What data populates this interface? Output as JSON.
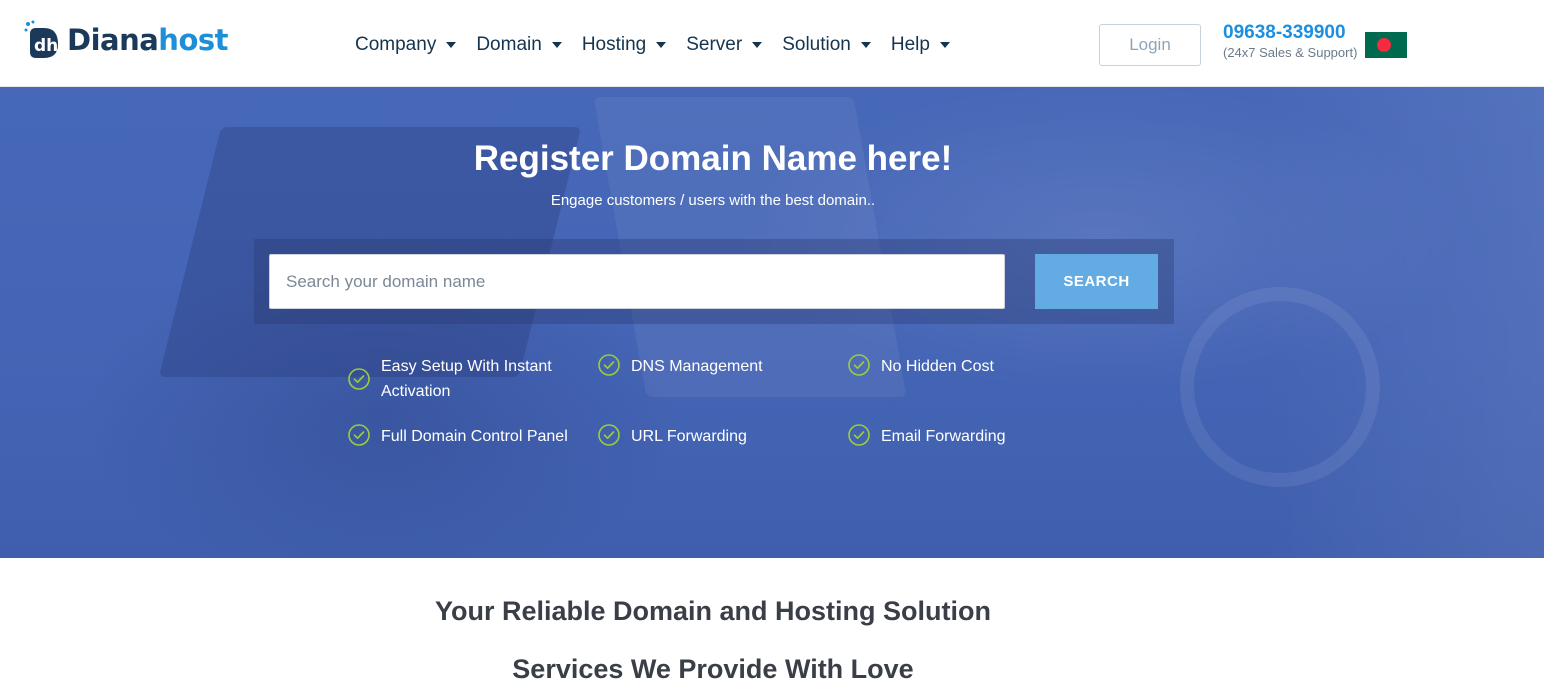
{
  "header": {
    "logo": {
      "text_part1": "Diana",
      "text_part2": "host",
      "icon": "dh-logo-icon"
    },
    "nav": [
      {
        "label": "Company"
      },
      {
        "label": "Domain"
      },
      {
        "label": "Hosting"
      },
      {
        "label": "Server"
      },
      {
        "label": "Solution"
      },
      {
        "label": "Help"
      }
    ],
    "login_label": "Login",
    "phone": {
      "number": "09638-339900",
      "note": "(24x7 Sales & Support)"
    },
    "flag": "bangladesh-flag-icon"
  },
  "hero": {
    "title": "Register Domain Name here!",
    "subtitle": "Engage customers / users with the best domain..",
    "search": {
      "placeholder": "Search your domain name",
      "value": "",
      "button_label": "SEARCH"
    },
    "features": [
      {
        "label": "Easy Setup With Instant Activation",
        "icon": "check-circle-icon"
      },
      {
        "label": "DNS Management",
        "icon": "check-circle-icon"
      },
      {
        "label": "No Hidden Cost",
        "icon": "check-circle-icon"
      },
      {
        "label": "Full Domain Control Panel",
        "icon": "check-circle-icon"
      },
      {
        "label": "URL Forwarding",
        "icon": "check-circle-icon"
      },
      {
        "label": "Email Forwarding",
        "icon": "check-circle-icon"
      }
    ]
  },
  "sections": {
    "heading1": "Your Reliable Domain and Hosting Solution",
    "heading2": "Services We Provide With Love"
  },
  "colors": {
    "accent": "#1d8fe0",
    "hero_bg": "#4566b6",
    "search_button": "#62abe3",
    "check": "#9ccc3d"
  }
}
